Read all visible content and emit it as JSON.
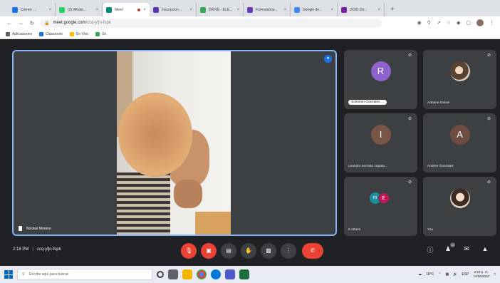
{
  "browser": {
    "tabs": [
      {
        "label": "Correo: ...",
        "color": "#1a73e8"
      },
      {
        "label": "(3) Whats...",
        "color": "#25d366"
      },
      {
        "label": "Meet",
        "color": "#00897b",
        "active": true,
        "recording": true
      },
      {
        "label": "Inscripcion...",
        "color": "#5e35b1"
      },
      {
        "label": "DRIVE - ELE...",
        "color": "#34a853"
      },
      {
        "label": "Formularios...",
        "color": "#673ab7"
      },
      {
        "label": "Google de...",
        "color": "#4285f4"
      },
      {
        "label": "DOID Dir...",
        "color": "#7b1fa2"
      }
    ],
    "new_tab_label": "+",
    "url_host": "meet.google.com",
    "url_path": "/ccq-yfjn-fspk",
    "bookmarks": [
      {
        "label": "Aplicaciones",
        "color": "#5f6368"
      },
      {
        "label": "Classroom",
        "color": "#1a73e8"
      },
      {
        "label": "En Vivo",
        "color": "#fbbc04"
      },
      {
        "label": "Sii",
        "color": "#34a853"
      }
    ]
  },
  "meet": {
    "main_tile": {
      "name": "Nicolas Moreno"
    },
    "participants": [
      {
        "name": "Solomon Gonzalez ...",
        "initial": "R",
        "color": "#8e63ce",
        "type": "initial",
        "chip": true
      },
      {
        "name": "Adriana Daniel",
        "type": "photo",
        "photo_class": "photo"
      },
      {
        "name": "Leandro serrado zapata...",
        "initial": "I",
        "color": "#795548",
        "type": "initial"
      },
      {
        "name": "Andrés Gonzalez",
        "initial": "A",
        "color": "#6d4c41",
        "type": "initial"
      },
      {
        "name": "6 others",
        "type": "others",
        "others_a": "m",
        "others_b": "E"
      },
      {
        "name": "You",
        "type": "photo",
        "photo_class": "photo2"
      }
    ],
    "time": "2:18 PM",
    "meeting_code": "ccq-yfjn-fspk",
    "people_count": "13",
    "icons": {
      "mic": "mic-off-icon",
      "camera": "camera-off-icon",
      "captions": "captions-icon",
      "hand": "raise-hand-icon",
      "present": "present-icon",
      "more": "more-icon",
      "hangup": "hangup-icon",
      "info": "info-icon",
      "people": "people-icon",
      "chat": "chat-icon",
      "activities": "activities-icon"
    }
  },
  "taskbar": {
    "search_placeholder": "Escribe aquí para buscar",
    "weather": "18°C",
    "lang": "ESP",
    "time": "2:18 p. m.",
    "date": "12/05/2022"
  }
}
